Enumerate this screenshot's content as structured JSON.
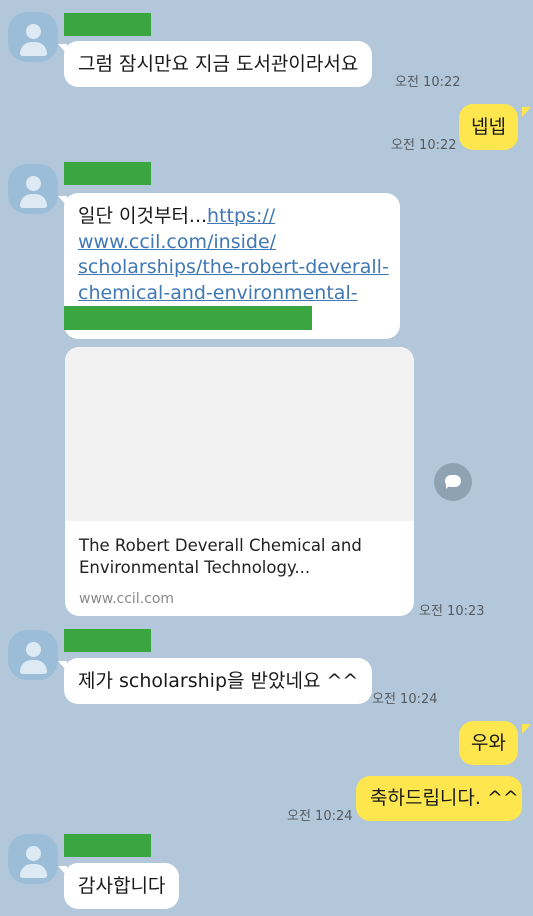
{
  "messages": {
    "m1": {
      "text": "그럼 잠시만요 지금 도서관이라서요",
      "time": "오전 10:22"
    },
    "m2": {
      "text": "넵넵",
      "time": "오전 10:22"
    },
    "m3": {
      "prefix": "일단 이것부터...",
      "link_lines": [
        "https://",
        "www.ccil.com/inside/",
        "scholarships/the-robert-deverall-",
        "chemical-and-environmental-"
      ]
    },
    "m4": {
      "title_line1": "The Robert Deverall Chemical and",
      "title_line2": "Environmental Technology...",
      "domain": "www.ccil.com",
      "time": "오전 10:23"
    },
    "m5": {
      "text": "제가 scholarship을 받았네요 ^^",
      "time": "오전 10:24"
    },
    "m6": {
      "text": "우와"
    },
    "m7": {
      "text": "축하드립니다. ^^",
      "time": "오전 10:24"
    },
    "m8": {
      "text": "감사합니다"
    }
  },
  "icons": {
    "avatar": "default-profile-icon",
    "share": "share-chat-icon"
  },
  "colors": {
    "background": "#b2c7da",
    "incoming_bubble": "#ffffff",
    "outgoing_bubble": "#fee64e",
    "link": "#3f78b5",
    "redaction": "#3aa63f"
  }
}
